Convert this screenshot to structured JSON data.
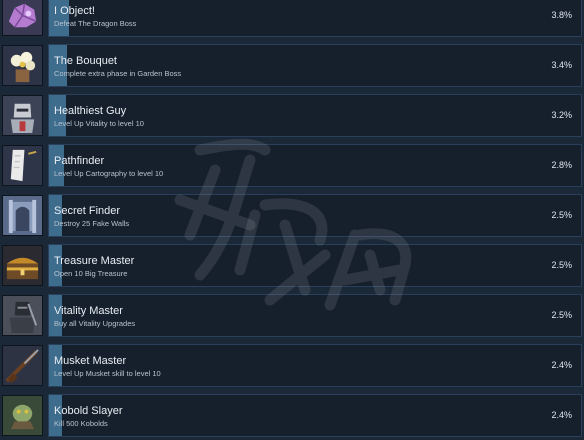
{
  "achievements": [
    {
      "title": "I Object!",
      "description": "Defeat The Dragon Boss",
      "percent": "3.8%",
      "progress": 0.038,
      "icon": "purple-crystal-icon"
    },
    {
      "title": "The Bouquet",
      "description": "Complete extra phase in Garden Boss",
      "percent": "3.4%",
      "progress": 0.034,
      "icon": "flower-bouquet-icon"
    },
    {
      "title": "Healthiest Guy",
      "description": "Level Up Vitality to level 10",
      "percent": "3.2%",
      "progress": 0.032,
      "icon": "armored-knight-icon"
    },
    {
      "title": "Pathfinder",
      "description": "Level Up Cartography to level 10",
      "percent": "2.8%",
      "progress": 0.028,
      "icon": "map-scroll-icon"
    },
    {
      "title": "Secret Finder",
      "description": "Destroy 25 Fake Walls",
      "percent": "2.5%",
      "progress": 0.025,
      "icon": "secret-wall-icon"
    },
    {
      "title": "Treasure Master",
      "description": "Open 10 Big Treasure",
      "percent": "2.5%",
      "progress": 0.025,
      "icon": "treasure-chest-icon"
    },
    {
      "title": "Vitality Master",
      "description": "Buy all Vitality Upgrades",
      "percent": "2.5%",
      "progress": 0.025,
      "icon": "dark-knight-icon"
    },
    {
      "title": "Musket Master",
      "description": "Level Up Musket skill to level 10",
      "percent": "2.4%",
      "progress": 0.024,
      "icon": "musket-icon"
    },
    {
      "title": "Kobold Slayer",
      "description": "Kill 500 Kobolds",
      "percent": "2.4%",
      "progress": 0.024,
      "icon": "kobold-icon"
    }
  ],
  "colors": {
    "background": "#1b2838",
    "bar": "#16202d",
    "bar_border": "#2a3f5a",
    "progress_fill": "#3d6c8d"
  }
}
